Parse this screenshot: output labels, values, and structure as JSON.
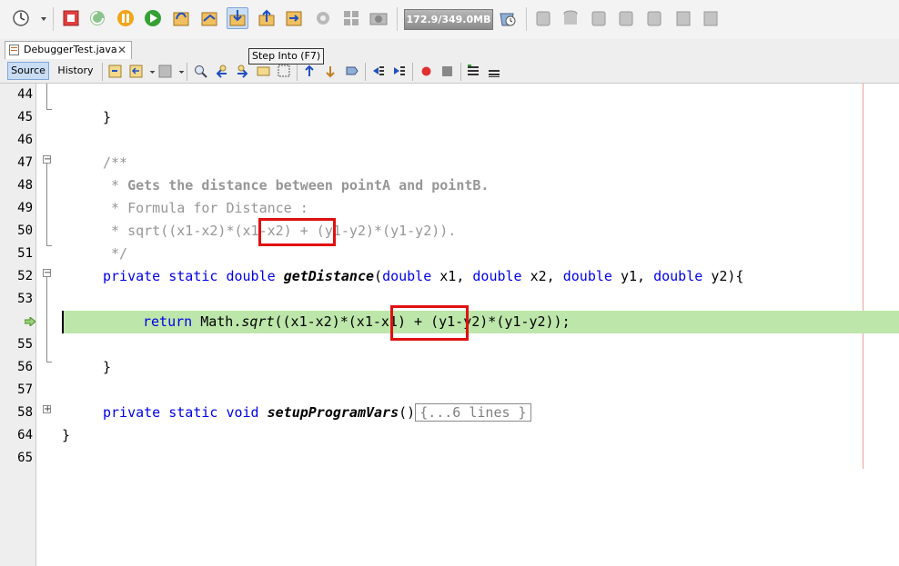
{
  "toolbar": {
    "memory_label": "172.9/349.0MB",
    "tooltip": "Step Into (F7)"
  },
  "editor_tab": {
    "file_name": "DebuggerTest.java",
    "close_glyph": "✕"
  },
  "editor_toolbar": {
    "source_label": "Source",
    "history_label": "History"
  },
  "lines": [
    {
      "num": "44"
    },
    {
      "num": "45"
    },
    {
      "num": "46"
    },
    {
      "num": "47"
    },
    {
      "num": "48"
    },
    {
      "num": "49"
    },
    {
      "num": "50"
    },
    {
      "num": "51"
    },
    {
      "num": "52"
    },
    {
      "num": "53"
    },
    {
      "num": ""
    },
    {
      "num": "55"
    },
    {
      "num": "56"
    },
    {
      "num": "57"
    },
    {
      "num": "58"
    },
    {
      "num": "64"
    },
    {
      "num": "65"
    }
  ],
  "code": {
    "l45": "}",
    "l47": "/**",
    "l48_a": " * ",
    "l48_b": "Gets the distance between pointA and pointB.",
    "l49": " * Formula for Distance :",
    "l50_a": " * sqrt((x1-x2)*",
    "l50_b": "(x1-x2)",
    "l50_c": " + (y1-y2)*(y1-y2)).",
    "l51": " */",
    "l52_kw1": "private",
    "l52_kw2": "static",
    "l52_kw3": "double",
    "l52_name": "getDistance",
    "l52_p1t": "double",
    "l52_p1": "x1,",
    "l52_p2t": "double",
    "l52_p2": "x2,",
    "l52_p3t": "double",
    "l52_p3": "y1,",
    "l52_p4t": "double",
    "l52_p4": "y2){",
    "l54_kw": "return",
    "l54_a": "Math.",
    "l54_m": "sqrt",
    "l54_b": "((x1-x2)*",
    "l54_c": "(x1-x1)",
    "l54_d": " + (y1-y2)*(y1-y2));",
    "l56": "}",
    "l58_kw1": "private",
    "l58_kw2": "static",
    "l58_kw3": "void",
    "l58_name": "setupProgramVars",
    "l58_paren": "()",
    "l58_fold": "{...6 lines }",
    "l64": "}"
  },
  "colors": {
    "keyword": "#0000e6",
    "comment": "#969696",
    "current_line": "#bde6aa",
    "annotation_box": "#e01010"
  }
}
